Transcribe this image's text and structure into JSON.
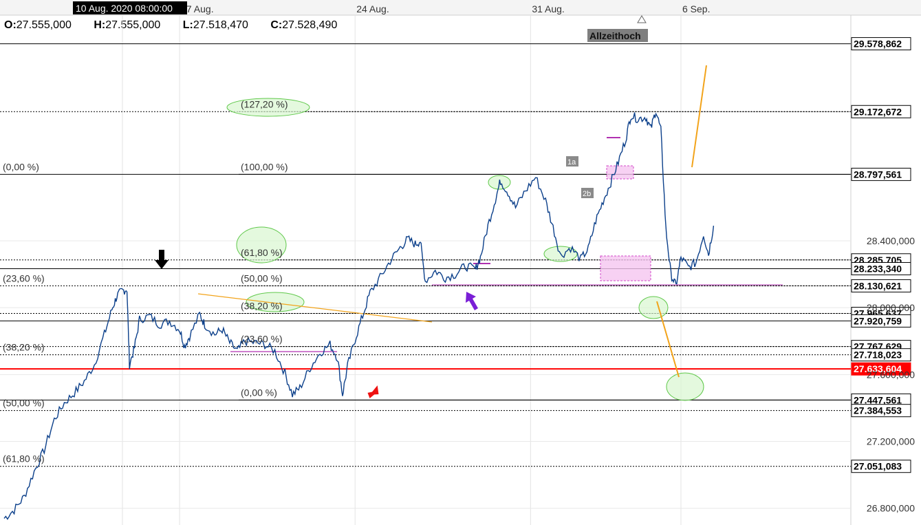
{
  "header": {
    "crosshair_time": "10 Aug. 2020 08:00:00",
    "open_label": "O:",
    "open_value": "27.555,000",
    "high_label": "H:",
    "high_value": "27.555,000",
    "low_label": "L:",
    "low_value": "27.518,470",
    "close_label": "C:",
    "close_value": "27.528,490"
  },
  "colors": {
    "price_line": "#0b3f8a",
    "support_red": "#ff0000",
    "fib_green_fill": "#d9f7d0",
    "fib_green_stroke": "#5fc84a",
    "zone_pink": "#f5c6f0",
    "zone_pink_stroke": "#d048c8",
    "trend_orange": "#f2a31a",
    "arrow_red": "#ee1111",
    "arrow_purple": "#7a1fd6"
  },
  "chart_data": {
    "type": "line",
    "x_ticks": [
      {
        "label": "17 Aug.",
        "day": 7
      },
      {
        "label": "24 Aug.",
        "day": 14
      },
      {
        "label": "31 Aug.",
        "day": 21
      },
      {
        "label": "6 Sep.",
        "day": 27
      }
    ],
    "ylim": [
      26700,
      29750
    ],
    "y_ticks": [
      "26.800,000",
      "27.200,000",
      "27.600,000",
      "28.000,000",
      "28.400,000"
    ],
    "y_tick_values": [
      26800,
      27200,
      27600,
      28000,
      28400
    ],
    "price_levels": [
      {
        "label": "29.578,862",
        "value": 29578.862,
        "style": "solid"
      },
      {
        "label": "29.172,672",
        "value": 29172.672,
        "style": "dotted"
      },
      {
        "label": "28.797,561",
        "value": 28797.561,
        "style": "solid"
      },
      {
        "label": "28.285,705",
        "value": 28285.705,
        "style": "dotted"
      },
      {
        "label": "28.233,340",
        "value": 28233.34,
        "style": "solid"
      },
      {
        "label": "28.130,621",
        "value": 28130.621,
        "style": "dotted"
      },
      {
        "label": "27.965,637",
        "value": 27965.637,
        "style": "dotted"
      },
      {
        "label": "27.920,759",
        "value": 27920.759,
        "style": "solid"
      },
      {
        "label": "27.767,629",
        "value": 27767.629,
        "style": "dotted"
      },
      {
        "label": "27.718,023",
        "value": 27718.023,
        "style": "dotted"
      },
      {
        "label": "27.633,604",
        "value": 27633.604,
        "style": "red"
      },
      {
        "label": "27.447,561",
        "value": 27447.561,
        "style": "solid"
      },
      {
        "label": "27.384,553",
        "value": 27384.553,
        "style": "dotted"
      },
      {
        "label": "27.051,083",
        "value": 27051.083,
        "style": "dotted"
      }
    ],
    "fib_left": [
      {
        "label": "(0,00 %)",
        "value": 28797.561
      },
      {
        "label": "(23,60 %)",
        "value": 28130.621
      },
      {
        "label": "(38,20 %)",
        "value": 27718.023
      },
      {
        "label": "(50,00 %)",
        "value": 27384.553
      },
      {
        "label": "(61,80 %)",
        "value": 27051.083
      }
    ],
    "fib_mid": [
      {
        "label": "(127,20 %)",
        "value": 29172.672
      },
      {
        "label": "(100,00 %)",
        "value": 28797.561
      },
      {
        "label": "(61,80 %)",
        "value": 28285.705
      },
      {
        "label": "(50,00 %)",
        "value": 28130.621
      },
      {
        "label": "(38,20 %)",
        "value": 27965.637
      },
      {
        "label": "(23,60 %)",
        "value": 27767.629
      },
      {
        "label": "(0,00 %)",
        "value": 27447.561
      }
    ],
    "annotations": {
      "ath_label": "Allzeithoch",
      "wave_1a": "1a",
      "wave_2b": "2b"
    },
    "price_series": [
      [
        0.0,
        26740
      ],
      [
        0.4,
        26790
      ],
      [
        0.8,
        26870
      ],
      [
        1.2,
        27020
      ],
      [
        1.6,
        27150
      ],
      [
        2.0,
        27330
      ],
      [
        2.4,
        27430
      ],
      [
        2.8,
        27490
      ],
      [
        3.2,
        27560
      ],
      [
        3.6,
        27660
      ],
      [
        4.0,
        27840
      ],
      [
        4.3,
        27990
      ],
      [
        4.5,
        28070
      ],
      [
        4.7,
        28100
      ],
      [
        4.9,
        28110
      ],
      [
        5.0,
        27660
      ],
      [
        5.2,
        27760
      ],
      [
        5.4,
        27930
      ],
      [
        5.8,
        27950
      ],
      [
        6.2,
        27900
      ],
      [
        6.6,
        27920
      ],
      [
        7.0,
        27870
      ],
      [
        7.2,
        27770
      ],
      [
        7.4,
        27830
      ],
      [
        7.8,
        27960
      ],
      [
        8.0,
        27900
      ],
      [
        8.4,
        27840
      ],
      [
        8.7,
        27870
      ],
      [
        9.0,
        27790
      ],
      [
        9.3,
        27740
      ],
      [
        9.6,
        27800
      ],
      [
        10.0,
        27790
      ],
      [
        10.4,
        27780
      ],
      [
        10.8,
        27740
      ],
      [
        11.2,
        27610
      ],
      [
        11.5,
        27480
      ],
      [
        11.8,
        27520
      ],
      [
        12.2,
        27640
      ],
      [
        12.6,
        27730
      ],
      [
        13.0,
        27780
      ],
      [
        13.3,
        27700
      ],
      [
        13.5,
        27480
      ],
      [
        13.7,
        27650
      ],
      [
        14.0,
        27810
      ],
      [
        14.3,
        27950
      ],
      [
        14.6,
        28090
      ],
      [
        15.0,
        28180
      ],
      [
        15.4,
        28280
      ],
      [
        15.8,
        28360
      ],
      [
        16.1,
        28410
      ],
      [
        16.4,
        28380
      ],
      [
        16.6,
        28400
      ],
      [
        16.8,
        28160
      ],
      [
        17.2,
        28220
      ],
      [
        17.6,
        28180
      ],
      [
        18.0,
        28200
      ],
      [
        18.4,
        28250
      ],
      [
        18.8,
        28230
      ],
      [
        19.0,
        28300
      ],
      [
        19.3,
        28490
      ],
      [
        19.6,
        28650
      ],
      [
        19.8,
        28760
      ],
      [
        20.1,
        28690
      ],
      [
        20.4,
        28600
      ],
      [
        20.8,
        28700
      ],
      [
        21.2,
        28780
      ],
      [
        21.6,
        28640
      ],
      [
        21.9,
        28480
      ],
      [
        22.2,
        28310
      ],
      [
        22.6,
        28360
      ],
      [
        23.0,
        28290
      ],
      [
        23.3,
        28350
      ],
      [
        23.6,
        28520
      ],
      [
        23.9,
        28640
      ],
      [
        24.2,
        28750
      ],
      [
        24.5,
        28870
      ],
      [
        24.8,
        29010
      ],
      [
        25.0,
        29150
      ],
      [
        25.3,
        29130
      ],
      [
        25.6,
        29140
      ],
      [
        25.8,
        29070
      ],
      [
        26.0,
        29180
      ],
      [
        26.2,
        29060
      ],
      [
        26.4,
        28470
      ],
      [
        26.6,
        28200
      ],
      [
        26.8,
        28130
      ],
      [
        27.0,
        28300
      ],
      [
        27.3,
        28240
      ],
      [
        27.6,
        28270
      ],
      [
        27.9,
        28440
      ],
      [
        28.1,
        28320
      ],
      [
        28.3,
        28490
      ]
    ],
    "series_x_range": [
      0,
      28.3
    ],
    "day_scale": {
      "day0": 0,
      "day27": 27
    }
  }
}
